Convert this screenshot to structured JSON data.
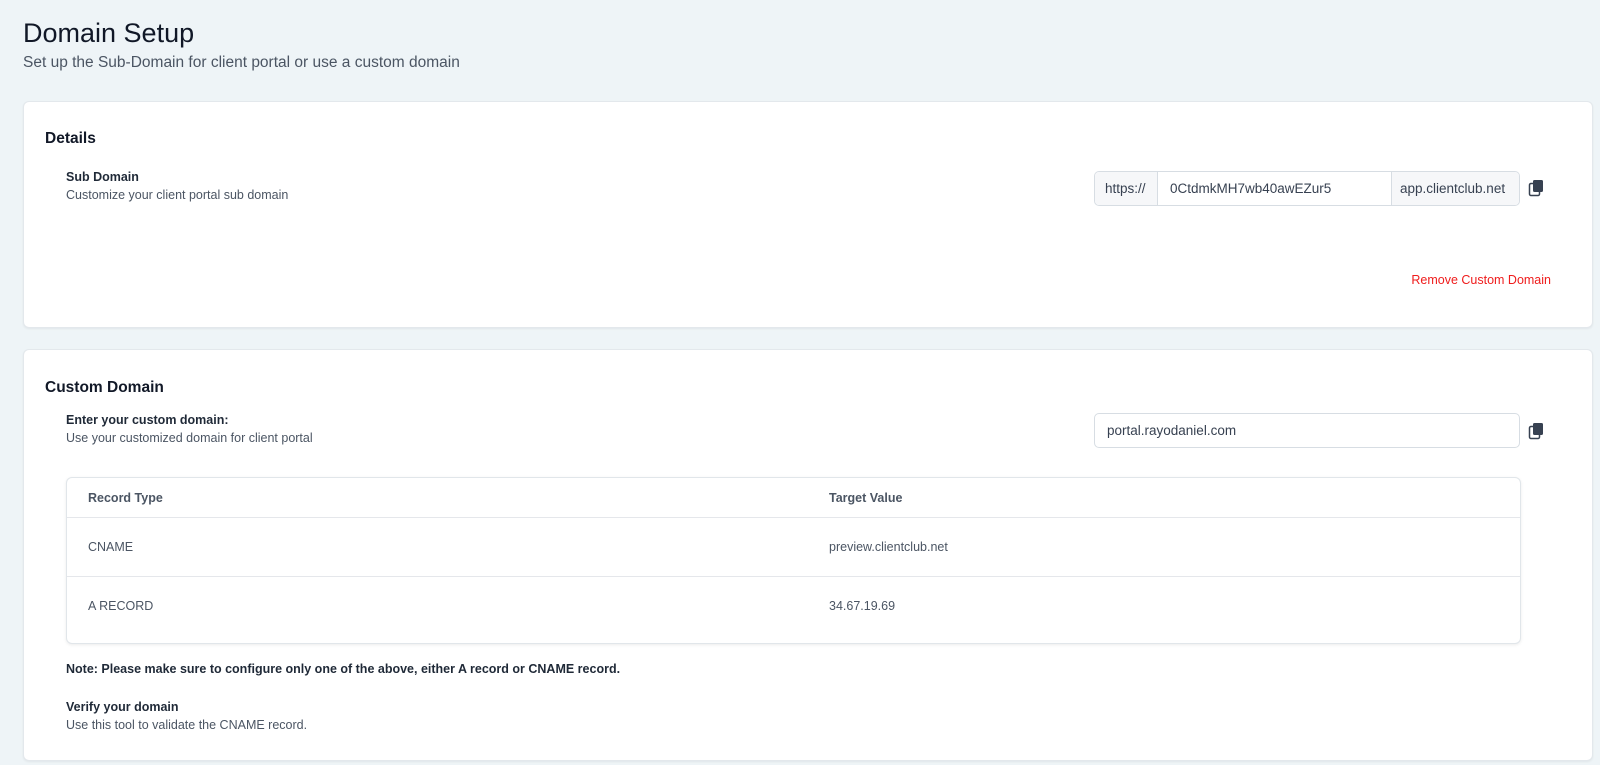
{
  "header": {
    "title": "Domain Setup",
    "subtitle": "Set up the Sub-Domain for client portal or use a custom domain"
  },
  "details": {
    "title": "Details",
    "sub_domain": {
      "label": "Sub Domain",
      "help": "Customize your client portal sub domain",
      "prefix": "https://",
      "value": "0CtdmkMH7wb40awEZur5",
      "suffix": "app.clientclub.net"
    },
    "remove_link": "Remove Custom Domain"
  },
  "custom_domain": {
    "title": "Custom Domain",
    "label": "Enter your custom domain:",
    "help": "Use your customized domain for client portal",
    "value": "portal.rayodaniel.com",
    "table": {
      "headers": [
        "Record Type",
        "Target Value"
      ],
      "rows": [
        [
          "CNAME",
          "preview.clientclub.net"
        ],
        [
          "A RECORD",
          "34.67.19.69"
        ]
      ]
    },
    "note": "Note: Please make sure to configure only one of the above, either A record or CNAME record.",
    "verify": {
      "label": "Verify your domain",
      "help": "Use this tool to validate the CNAME record."
    }
  },
  "icons": {
    "copy": "copy-icon"
  }
}
